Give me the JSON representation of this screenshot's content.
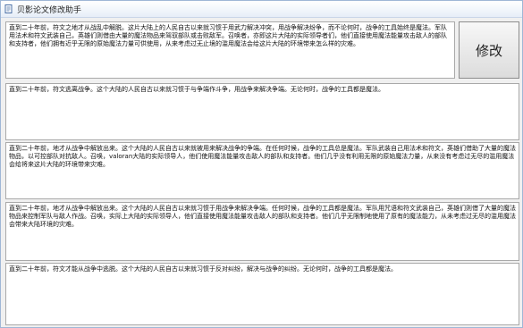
{
  "window": {
    "title": "贝影论文修改助手",
    "app_icon": "document-icon"
  },
  "buttons": {
    "edit_label": "修改"
  },
  "textboxes": [
    "直到二十年前，符文之地才从战乱中解脱。这片大陆上的人民自古以来就习惯于用武力解决冲突，用战争解决纷争，而不论何时，战争的工具始终是魔法。军队用法术和符文武装自己，英雄们则借由大量的魔法物品来驾驭部队或击败敌军。召唤者，亦即这片大陆的实际领导者们，他们直接使用魔法能量攻击敌人的部队和支持者，他们拥有近乎无限的原始魔法力量可供使用，从来考虑过无止境的滥用魔法会给这片大陆的环境带来怎么样的灾难。",
    "直到二十年前，符文逃离战争。这个大陆的人民自古以来就习惯于与争端作斗争，用战争来解决争端。无论何时，战争的工具都是魔法。",
    "直到二十年前，地才从战争中解放出来。这个大陆的人民自古以来就被用来解决战争的争端。在任何时候，战争的工具总是魔法。军队武装自己用法术和符文，英雄们借助了大量的魔法物品，以可控部队对抗敌人。召唤，valoran大陆的实际领导人，他们使用魔法能量攻击敌人的部队和支持者。他们几乎没有利用无限的原始魔法力量，从来没有考虑过无尽的滥用魔法会给将来这片大陆的环境带来灾难。",
    "直到二十年前，地才从战争中解放出来。这个大陆的人民自古以来就习惯于用战争来解决争端。任何时候，战争的工具都是魔法。军队用咒语和符文武装自己，英雄们则借了大量的魔法物品来控制军队与敌人作战。召唤，实际上大陆的实际领导人，他们直接使用魔法能量攻击敌人的部队和支持者。他们几乎无限制地使用了原有的魔法能力，从未考虑过无尽的滥用魔法会带来大陆环境的灾难。",
    "直到二十年前，符文才能从战争中逃脱。这个大陆的人民自古以来就习惯于反对纠纷，解决与战争的纠纷。无论何时，战争的工具都是魔法。"
  ]
}
